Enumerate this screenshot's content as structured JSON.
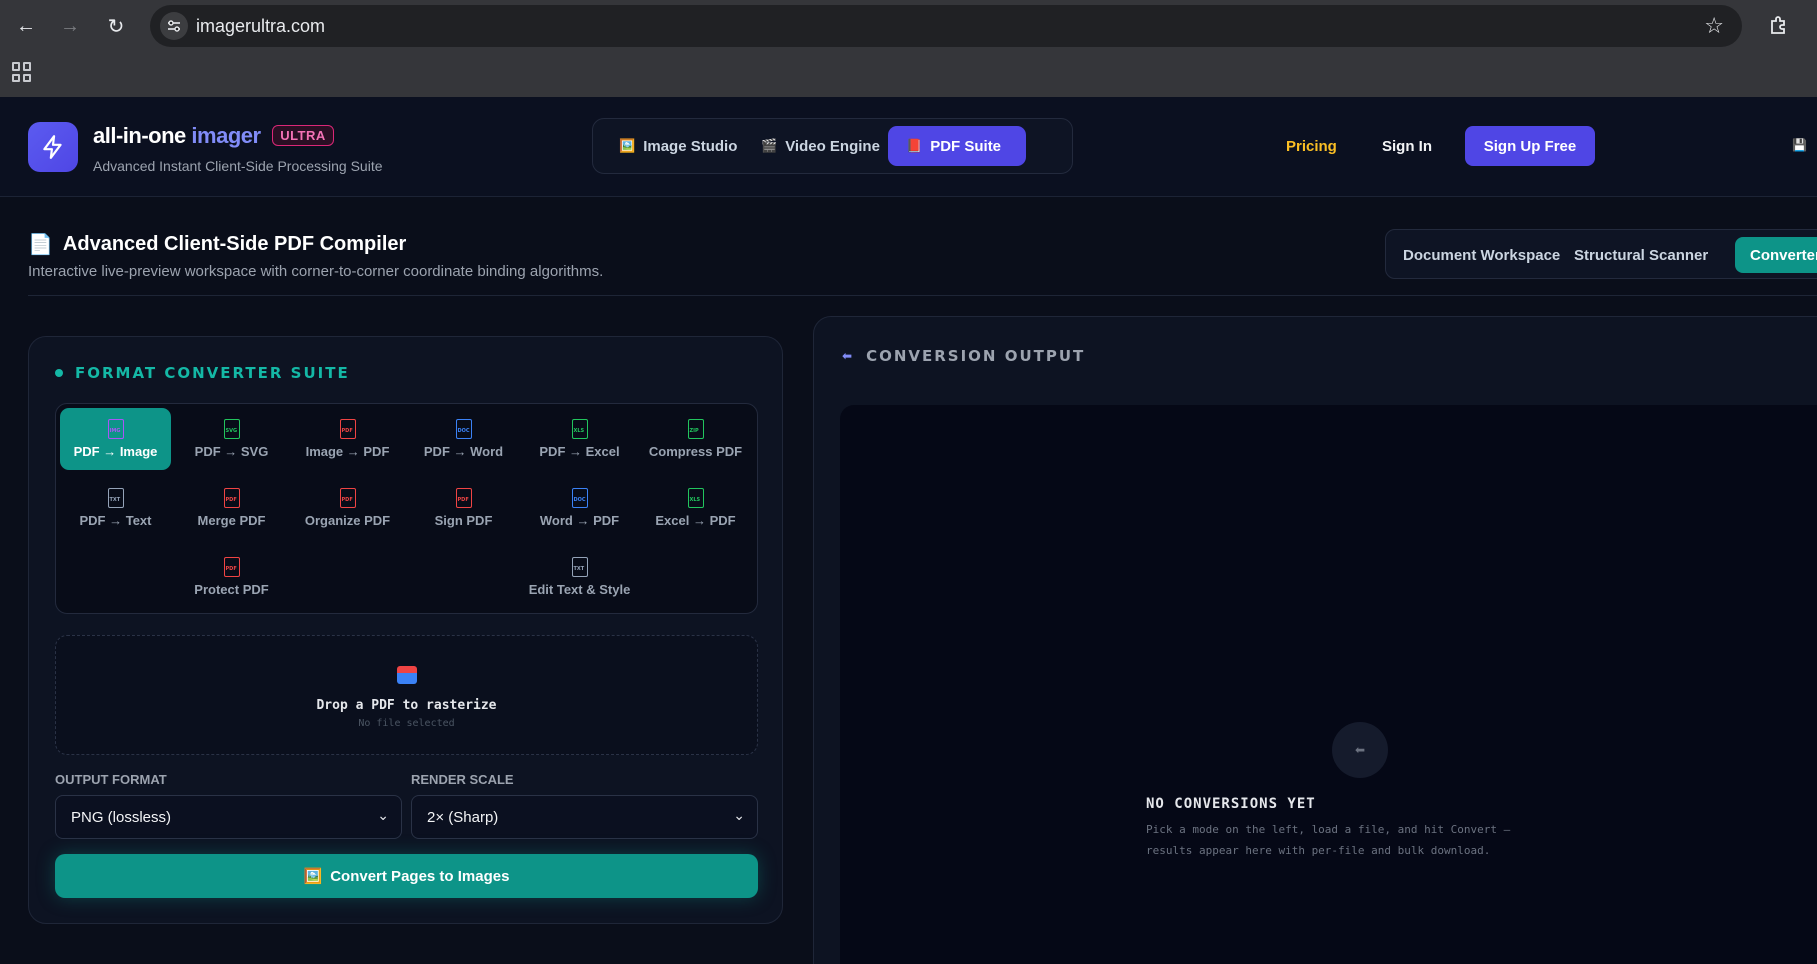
{
  "browser": {
    "url": "imagerultra.com"
  },
  "header": {
    "brand_part1": "all-in-one",
    "brand_part2": "imager",
    "badge": "ULTRA",
    "tagline": "Advanced Instant Client-Side Processing Suite",
    "suite_tabs": [
      {
        "icon": "🖼️",
        "label": "Image Studio"
      },
      {
        "icon": "🎬",
        "label": "Video Engine"
      },
      {
        "icon": "📕",
        "label": "PDF Suite"
      }
    ],
    "pricing": "Pricing",
    "sign_in": "Sign In",
    "sign_up": "Sign Up Free"
  },
  "page": {
    "title": "Advanced Client-Side PDF Compiler",
    "subtitle": "Interactive live-preview workspace with corner-to-corner coordinate binding algorithms.",
    "mode_tabs": [
      "Document Workspace",
      "Structural Scanner",
      "Converter"
    ]
  },
  "converter": {
    "heading": "FORMAT CONVERTER SUITE",
    "tools": [
      {
        "label": "PDF → Image",
        "tag": "IMG"
      },
      {
        "label": "PDF → SVG",
        "tag": "SVG"
      },
      {
        "label": "Image → PDF",
        "tag": "PDF"
      },
      {
        "label": "PDF → Word",
        "tag": "DOC"
      },
      {
        "label": "PDF → Excel",
        "tag": "XLS"
      },
      {
        "label": "Compress PDF",
        "tag": "ZIP"
      },
      {
        "label": "PDF → Text",
        "tag": "TXT"
      },
      {
        "label": "Merge PDF",
        "tag": "PDF"
      },
      {
        "label": "Organize PDF",
        "tag": "PDF"
      },
      {
        "label": "Sign PDF",
        "tag": "PDF"
      },
      {
        "label": "Word → PDF",
        "tag": "DOC"
      },
      {
        "label": "Excel → PDF",
        "tag": "XLS"
      },
      {
        "label": "Protect PDF",
        "tag": "PDF"
      },
      {
        "label": "Edit Text & Style",
        "tag": "TXT"
      }
    ],
    "dropzone_title": "Drop a PDF to rasterize",
    "dropzone_sub": "No file selected",
    "output_format_label": "OUTPUT FORMAT",
    "output_format_value": "PNG (lossless)",
    "render_scale_label": "RENDER SCALE",
    "render_scale_value": "2× (Sharp)",
    "convert_button": "Convert Pages to Images",
    "convert_icon": "🖼️"
  },
  "output": {
    "heading": "CONVERSION OUTPUT",
    "empty_title": "NO CONVERSIONS YET",
    "empty_desc": "Pick a mode on the left, load a file, and hit Convert — results appear here with per-file and bulk download."
  },
  "colors": {
    "accent_indigo": "#4f46e5",
    "accent_teal": "#0d9488",
    "pricing_gold": "#fbbf24",
    "badge_pink": "#f472b6"
  }
}
